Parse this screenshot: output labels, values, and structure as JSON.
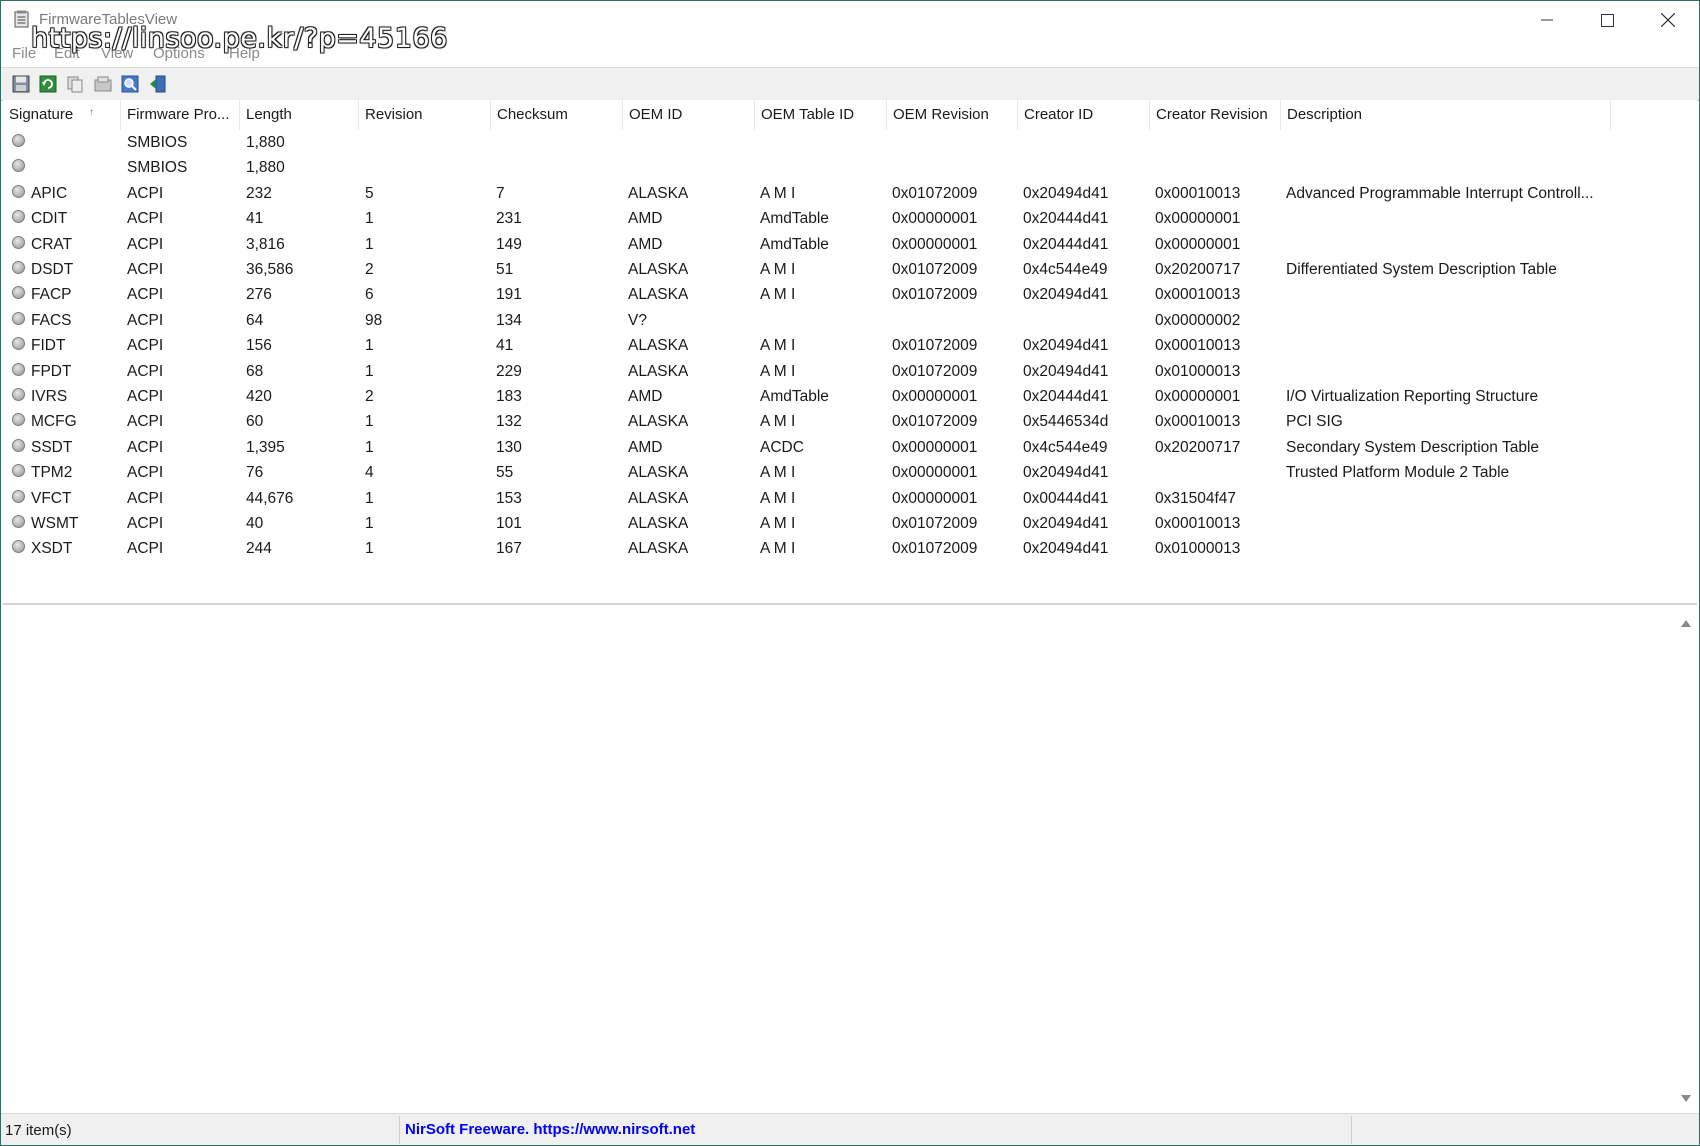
{
  "window": {
    "title": "FirmwareTablesView",
    "watermark": "https://linsoo.pe.kr/?p=45166",
    "controls": {
      "minimize": "—",
      "maximize": "☐",
      "close": "✕"
    }
  },
  "menu": [
    "File",
    "Edit",
    "View",
    "Options",
    "Help"
  ],
  "toolbar": {
    "buttons": [
      "save-icon",
      "refresh-icon",
      "copy-icon",
      "properties-icon",
      "find-icon",
      "exit-icon"
    ]
  },
  "table": {
    "columns": [
      "Signature",
      "Firmware Pro...",
      "Length",
      "Revision",
      "Checksum",
      "OEM ID",
      "OEM Table ID",
      "OEM Revision",
      "Creator ID",
      "Creator Revision",
      "Description"
    ],
    "sort_indicator": "↑",
    "rows": [
      [
        "",
        "SMBIOS",
        "1,880",
        "",
        "",
        "",
        "",
        "",
        "",
        "",
        ""
      ],
      [
        "",
        "SMBIOS",
        "1,880",
        "",
        "",
        "",
        "",
        "",
        "",
        "",
        ""
      ],
      [
        "APIC",
        "ACPI",
        "232",
        "5",
        "7",
        "ALASKA",
        "A M I",
        "0x01072009",
        "0x20494d41",
        "0x00010013",
        "Advanced Programmable Interrupt Controll..."
      ],
      [
        "CDIT",
        "ACPI",
        "41",
        "1",
        "231",
        "AMD",
        "AmdTable",
        "0x00000001",
        "0x20444d41",
        "0x00000001",
        ""
      ],
      [
        "CRAT",
        "ACPI",
        "3,816",
        "1",
        "149",
        "AMD",
        "AmdTable",
        "0x00000001",
        "0x20444d41",
        "0x00000001",
        ""
      ],
      [
        "DSDT",
        "ACPI",
        "36,586",
        "2",
        "51",
        "ALASKA",
        "A M I",
        "0x01072009",
        "0x4c544e49",
        "0x20200717",
        "Differentiated System Description Table"
      ],
      [
        "FACP",
        "ACPI",
        "276",
        "6",
        "191",
        "ALASKA",
        "A M I",
        "0x01072009",
        "0x20494d41",
        "0x00010013",
        ""
      ],
      [
        "FACS",
        "ACPI",
        "64",
        "98",
        "134",
        "V?",
        "",
        "",
        "",
        "0x00000002",
        ""
      ],
      [
        "FIDT",
        "ACPI",
        "156",
        "1",
        "41",
        "ALASKA",
        "A M I",
        "0x01072009",
        "0x20494d41",
        "0x00010013",
        ""
      ],
      [
        "FPDT",
        "ACPI",
        "68",
        "1",
        "229",
        "ALASKA",
        "A M I",
        "0x01072009",
        "0x20494d41",
        "0x01000013",
        ""
      ],
      [
        "IVRS",
        "ACPI",
        "420",
        "2",
        "183",
        "AMD",
        "AmdTable",
        "0x00000001",
        "0x20444d41",
        "0x00000001",
        "I/O Virtualization Reporting Structure"
      ],
      [
        "MCFG",
        "ACPI",
        "60",
        "1",
        "132",
        "ALASKA",
        "A M I",
        "0x01072009",
        "0x5446534d",
        "0x00010013",
        "PCI SIG"
      ],
      [
        "SSDT",
        "ACPI",
        "1,395",
        "1",
        "130",
        "AMD",
        "ACDC",
        "0x00000001",
        "0x4c544e49",
        "0x20200717",
        "Secondary System Description Table"
      ],
      [
        "TPM2",
        "ACPI",
        "76",
        "4",
        "55",
        "ALASKA",
        "A M I",
        "0x00000001",
        "0x20494d41",
        "",
        "Trusted Platform Module 2 Table"
      ],
      [
        "VFCT",
        "ACPI",
        "44,676",
        "1",
        "153",
        "ALASKA",
        "A M I",
        "0x00000001",
        "0x00444d41",
        "0x31504f47",
        ""
      ],
      [
        "WSMT",
        "ACPI",
        "40",
        "1",
        "101",
        "ALASKA",
        "A M I",
        "0x01072009",
        "0x20494d41",
        "0x00010013",
        ""
      ],
      [
        "XSDT",
        "ACPI",
        "244",
        "1",
        "167",
        "ALASKA",
        "A M I",
        "0x01072009",
        "0x20494d41",
        "0x01000013",
        ""
      ]
    ]
  },
  "status": {
    "count": "17 item(s)",
    "credit": "NirSoft Freeware. https://www.nirsoft.net"
  },
  "colors": {
    "credit": "#0000ff",
    "window_border": "#2f6f63"
  }
}
